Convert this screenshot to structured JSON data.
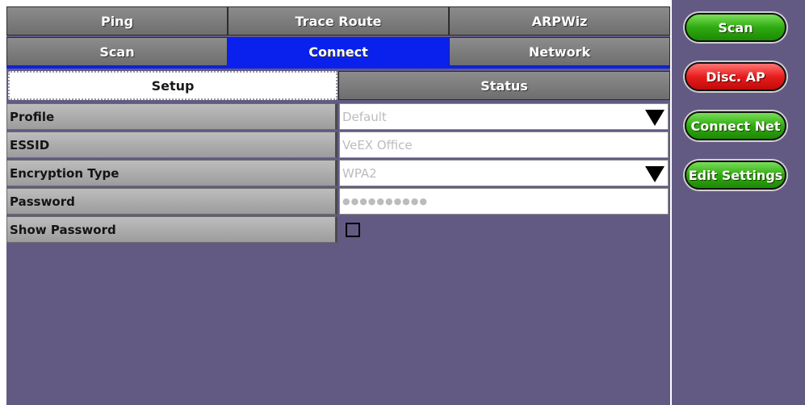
{
  "tabs_row1": [
    "Ping",
    "Trace Route",
    "ARPWiz"
  ],
  "tabs_row2": [
    "Scan",
    "Connect",
    "Network"
  ],
  "active_tab": "Connect",
  "subtabs": {
    "setup": "Setup",
    "status": "Status"
  },
  "form": {
    "profile": {
      "label": "Profile",
      "value": "Default"
    },
    "essid": {
      "label": "ESSID",
      "value": "VeEX Office"
    },
    "encryption": {
      "label": "Encryption Type",
      "value": "WPA2"
    },
    "password": {
      "label": "Password",
      "value": "●●●●●●●●●●"
    },
    "show_password": {
      "label": "Show Password",
      "checked": false
    }
  },
  "buttons": {
    "scan": "Scan",
    "disc_ap": "Disc. AP",
    "connect_net": "Connect Net",
    "edit_settings": "Edit Settings"
  },
  "colors": {
    "panel": "#635a84",
    "active_tab": "#0a21ee",
    "button_green": "#2faa10",
    "button_red": "#e81c1c"
  }
}
